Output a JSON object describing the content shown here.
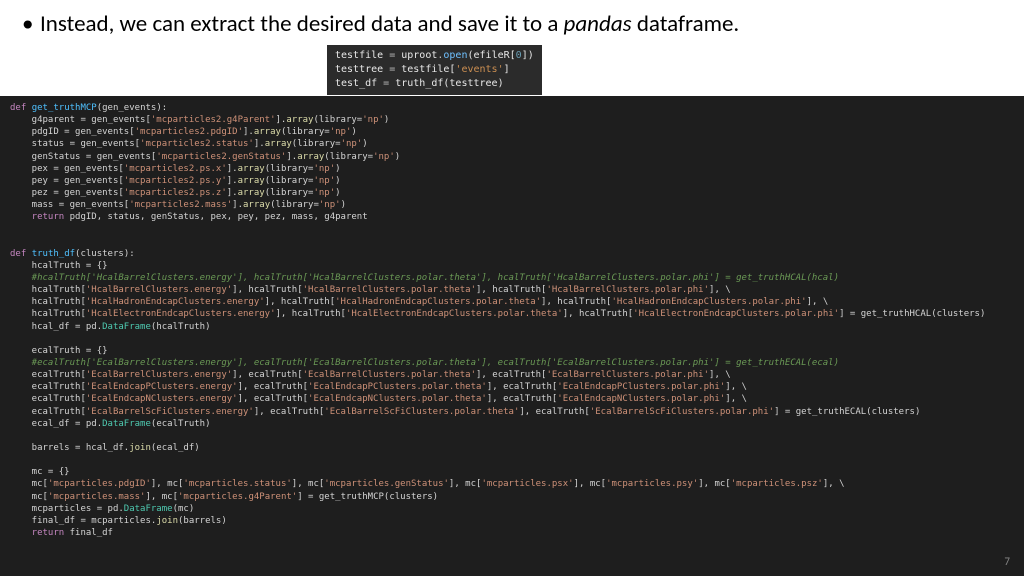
{
  "bullet": {
    "pre": "Instead, we can extract the desired data and save it to a ",
    "italic": "pandas",
    "post": " dataframe."
  },
  "snippet": {
    "l1a": "testfile ",
    "l1b": "= ",
    "l1c": "uproot",
    "l1d": ".",
    "l1e": "open",
    "l1f": "(efileR[",
    "l1g": "0",
    "l1h": "])",
    "l2a": "testtree ",
    "l2b": "= ",
    "l2c": "testfile[",
    "l2d": "'events'",
    "l2e": "]",
    "l3a": "test_df ",
    "l3b": "= ",
    "l3c": "truth_df(testtree)"
  },
  "code": {
    "f1_def": "def ",
    "f1_name": "get_truthMCP",
    "f1_args": "(gen_events):",
    "f1_l1": "    g4parent = gen_events[",
    "f1_s1": "'mcparticles2.g4Parent'",
    "f1_m1": "].",
    "f1_c1": "array",
    "f1_a1": "(library=",
    "f1_sv1": "'np'",
    "f1_e1": ")",
    "f1_l2": "    pdgID = gen_events[",
    "f1_s2": "'mcparticles2.pdgID'",
    "f1_m2": "].",
    "f1_c2": "array",
    "f1_a2": "(library=",
    "f1_sv2": "'np'",
    "f1_e2": ")",
    "f1_l3": "    status = gen_events[",
    "f1_s3": "'mcparticles2.status'",
    "f1_m3": "].",
    "f1_c3": "array",
    "f1_a3": "(library=",
    "f1_sv3": "'np'",
    "f1_e3": ")",
    "f1_l4": "    genStatus = gen_events[",
    "f1_s4": "'mcparticles2.genStatus'",
    "f1_m4": "].",
    "f1_c4": "array",
    "f1_a4": "(library=",
    "f1_sv4": "'np'",
    "f1_e4": ")",
    "f1_l5": "    pex = gen_events[",
    "f1_s5": "'mcparticles2.ps.x'",
    "f1_m5": "].",
    "f1_c5": "array",
    "f1_a5": "(library=",
    "f1_sv5": "'np'",
    "f1_e5": ")",
    "f1_l6": "    pey = gen_events[",
    "f1_s6": "'mcparticles2.ps.y'",
    "f1_m6": "].",
    "f1_c6": "array",
    "f1_a6": "(library=",
    "f1_sv6": "'np'",
    "f1_e6": ")",
    "f1_l7": "    pez = gen_events[",
    "f1_s7": "'mcparticles2.ps.z'",
    "f1_m7": "].",
    "f1_c7": "array",
    "f1_a7": "(library=",
    "f1_sv7": "'np'",
    "f1_e7": ")",
    "f1_l8": "    mass = gen_events[",
    "f1_s8": "'mcparticles2.mass'",
    "f1_m8": "].",
    "f1_c8": "array",
    "f1_a8": "(library=",
    "f1_sv8": "'np'",
    "f1_e8": ")",
    "f1_ret": "    return ",
    "f1_retv": "pdgID, status, genStatus, pex, pey, pez, mass, g4parent",
    "f2_def": "def ",
    "f2_name": "truth_df",
    "f2_args": "(clusters):",
    "f2_l1": "    hcalTruth = {}",
    "f2_c1": "    #hcalTruth['HcalBarrelClusters.energy'], hcalTruth['HcalBarrelClusters.polar.theta'], hcalTruth['HcalBarrelClusters.polar.phi'] = get_truthHCAL(hcal)",
    "f2_l2a": "    hcalTruth[",
    "f2_s2a": "'HcalBarrelClusters.energy'",
    "f2_l2b": "], hcalTruth[",
    "f2_s2b": "'HcalBarrelClusters.polar.theta'",
    "f2_l2c": "], hcalTruth[",
    "f2_s2c": "'HcalBarrelClusters.polar.phi'",
    "f2_l2d": "], \\",
    "f2_l3a": "    hcalTruth[",
    "f2_s3a": "'HcalHadronEndcapClusters.energy'",
    "f2_l3b": "], hcalTruth[",
    "f2_s3b": "'HcalHadronEndcapClusters.polar.theta'",
    "f2_l3c": "], hcalTruth[",
    "f2_s3c": "'HcalHadronEndcapClusters.polar.phi'",
    "f2_l3d": "], \\",
    "f2_l4a": "    hcalTruth[",
    "f2_s4a": "'HcalElectronEndcapClusters.energy'",
    "f2_l4b": "], hcalTruth[",
    "f2_s4b": "'HcalElectronEndcapClusters.polar.theta'",
    "f2_l4c": "], hcalTruth[",
    "f2_s4c": "'HcalElectronEndcapClusters.polar.phi'",
    "f2_l4d": "] = get_truthHCAL(clusters)",
    "f2_l5a": "    hcal_df = pd.",
    "f2_l5b": "DataFrame",
    "f2_l5c": "(hcalTruth)",
    "f2_l6": "    ecalTruth = {}",
    "f2_c2": "    #ecalTruth['EcalBarrelClusters.energy'], ecalTruth['EcalBarrelClusters.polar.theta'], ecalTruth['EcalBarrelClusters.polar.phi'] = get_truthECAL(ecal)",
    "f2_l7a": "    ecalTruth[",
    "f2_s7a": "'EcalBarrelClusters.energy'",
    "f2_l7b": "], ecalTruth[",
    "f2_s7b": "'EcalBarrelClusters.polar.theta'",
    "f2_l7c": "], ecalTruth[",
    "f2_s7c": "'EcalBarrelClusters.polar.phi'",
    "f2_l7d": "], \\",
    "f2_l8a": "    ecalTruth[",
    "f2_s8a": "'EcalEndcapPClusters.energy'",
    "f2_l8b": "], ecalTruth[",
    "f2_s8b": "'EcalEndcapPClusters.polar.theta'",
    "f2_l8c": "], ecalTruth[",
    "f2_s8c": "'EcalEndcapPClusters.polar.phi'",
    "f2_l8d": "], \\",
    "f2_l9a": "    ecalTruth[",
    "f2_s9a": "'EcalEndcapNClusters.energy'",
    "f2_l9b": "], ecalTruth[",
    "f2_s9b": "'EcalEndcapNClusters.polar.theta'",
    "f2_l9c": "], ecalTruth[",
    "f2_s9c": "'EcalEndcapNClusters.polar.phi'",
    "f2_l9d": "], \\",
    "f2_l10a": "    ecalTruth[",
    "f2_s10a": "'EcalBarrelScFiClusters.energy'",
    "f2_l10b": "], ecalTruth[",
    "f2_s10b": "'EcalBarrelScFiClusters.polar.theta'",
    "f2_l10c": "], ecalTruth[",
    "f2_s10c": "'EcalBarrelScFiClusters.polar.phi'",
    "f2_l10d": "] = get_truthECAL(clusters)",
    "f2_l11a": "    ecal_df = pd.",
    "f2_l11b": "DataFrame",
    "f2_l11c": "(ecalTruth)",
    "f2_l12a": "    barrels = hcal_df.",
    "f2_l12b": "join",
    "f2_l12c": "(ecal_df)",
    "f2_l13": "    mc = {}",
    "f2_l14a": "    mc[",
    "f2_s14a": "'mcparticles.pdgID'",
    "f2_l14b": "], mc[",
    "f2_s14b": "'mcparticles.status'",
    "f2_l14c": "], mc[",
    "f2_s14c": "'mcparticles.genStatus'",
    "f2_l14d": "], mc[",
    "f2_s14d": "'mcparticles.psx'",
    "f2_l14e": "], mc[",
    "f2_s14e": "'mcparticles.psy'",
    "f2_l14f": "], mc[",
    "f2_s14f": "'mcparticles.psz'",
    "f2_l14g": "], \\",
    "f2_l15a": "    mc[",
    "f2_s15a": "'mcparticles.mass'",
    "f2_l15b": "], mc[",
    "f2_s15b": "'mcparticles.g4Parent'",
    "f2_l15c": "] = get_truthMCP(clusters)",
    "f2_l16a": "    mcparticles = pd.",
    "f2_l16b": "DataFrame",
    "f2_l16c": "(mc)",
    "f2_l17a": "    final_df = mcparticles.",
    "f2_l17b": "join",
    "f2_l17c": "(barrels)",
    "f2_ret": "    return ",
    "f2_retv": "final_df"
  },
  "page_number": "7"
}
